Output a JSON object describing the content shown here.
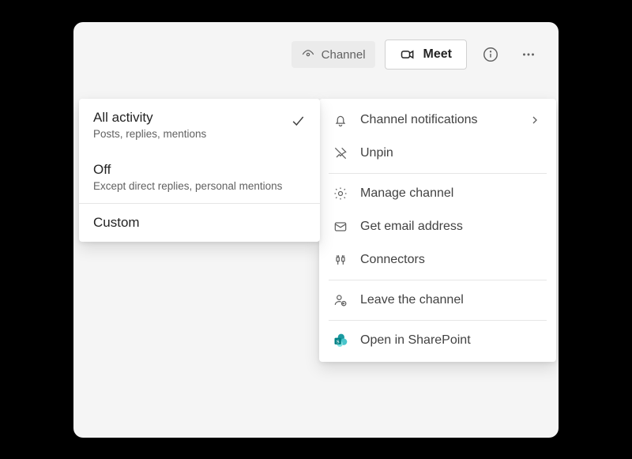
{
  "toolbar": {
    "channel_label": "Channel",
    "meet_label": "Meet"
  },
  "notifications_submenu": {
    "all": {
      "title": "All activity",
      "subtitle": "Posts, replies, mentions"
    },
    "off": {
      "title": "Off",
      "subtitle": "Except direct replies, personal mentions"
    },
    "custom": {
      "title": "Custom"
    }
  },
  "context_menu": {
    "notifications": "Channel notifications",
    "unpin": "Unpin",
    "manage": "Manage channel",
    "email": "Get email address",
    "connectors": "Connectors",
    "leave": "Leave the channel",
    "sharepoint": "Open in SharePoint"
  },
  "colors": {
    "sharepoint_accent": "#038387"
  }
}
